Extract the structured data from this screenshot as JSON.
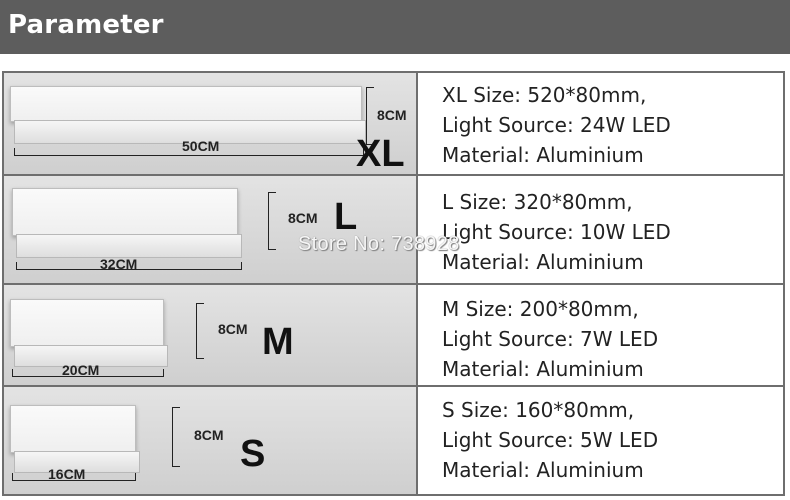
{
  "header": {
    "title": "Parameter"
  },
  "rows": [
    {
      "size_code": "XL",
      "width_label": "50CM",
      "height_label": "8CM",
      "spec_lines": [
        "XL Size: 520*80mm,",
        "Light Source: 24W LED",
        "Material: Aluminium"
      ]
    },
    {
      "size_code": "L",
      "width_label": "32CM",
      "height_label": "8CM",
      "spec_lines": [
        "L Size: 320*80mm,",
        "Light Source: 10W LED",
        "Material: Aluminium"
      ]
    },
    {
      "size_code": "M",
      "width_label": "20CM",
      "height_label": "8CM",
      "spec_lines": [
        "M Size: 200*80mm,",
        "Light Source: 7W LED",
        "Material: Aluminium"
      ]
    },
    {
      "size_code": "S",
      "width_label": "16CM",
      "height_label": "8CM",
      "spec_lines": [
        "S Size: 160*80mm,",
        "Light Source: 5W LED",
        "Material: Aluminium"
      ]
    }
  ],
  "watermark": "Store No: 738928",
  "colors": {
    "header_bg": "#5d5d5d",
    "border": "#6e6e6e",
    "image_bg": "#d9d9d9"
  }
}
